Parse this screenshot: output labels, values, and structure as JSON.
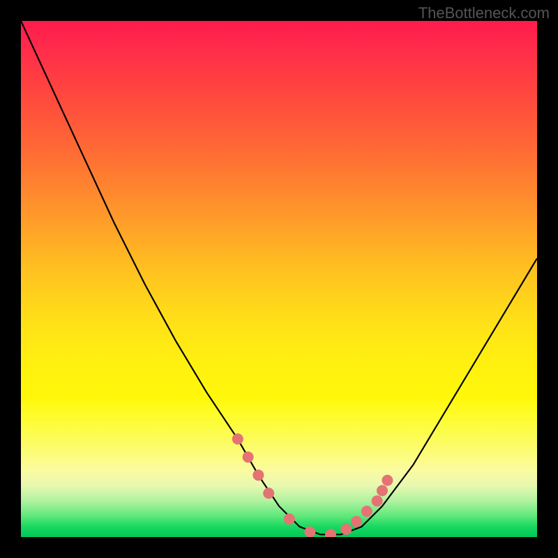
{
  "watermark": "TheBottleneck.com",
  "chart_data": {
    "type": "line",
    "title": "",
    "xlabel": "",
    "ylabel": "",
    "xlim": [
      0,
      100
    ],
    "ylim": [
      0,
      100
    ],
    "grid": false,
    "series": [
      {
        "name": "bottleneck-curve",
        "x": [
          0,
          6,
          12,
          18,
          24,
          30,
          36,
          42,
          46,
          50,
          54,
          58,
          62,
          66,
          70,
          76,
          82,
          88,
          94,
          100
        ],
        "y": [
          100,
          87,
          74,
          61,
          49,
          38,
          28,
          19,
          12,
          6,
          2,
          0.5,
          0.5,
          2,
          6,
          14,
          24,
          34,
          44,
          54
        ]
      }
    ],
    "markers": {
      "name": "highlight-dots",
      "x": [
        42,
        44,
        46,
        48,
        52,
        56,
        60,
        63,
        65,
        67,
        69,
        70,
        71
      ],
      "y": [
        19,
        15.5,
        12,
        8.5,
        3.5,
        1,
        0.5,
        1.5,
        3,
        5,
        7,
        9,
        11
      ]
    },
    "background_gradient": {
      "top": "#ff1a4d",
      "mid": "#ffe018",
      "bottom": "#00c858"
    }
  }
}
